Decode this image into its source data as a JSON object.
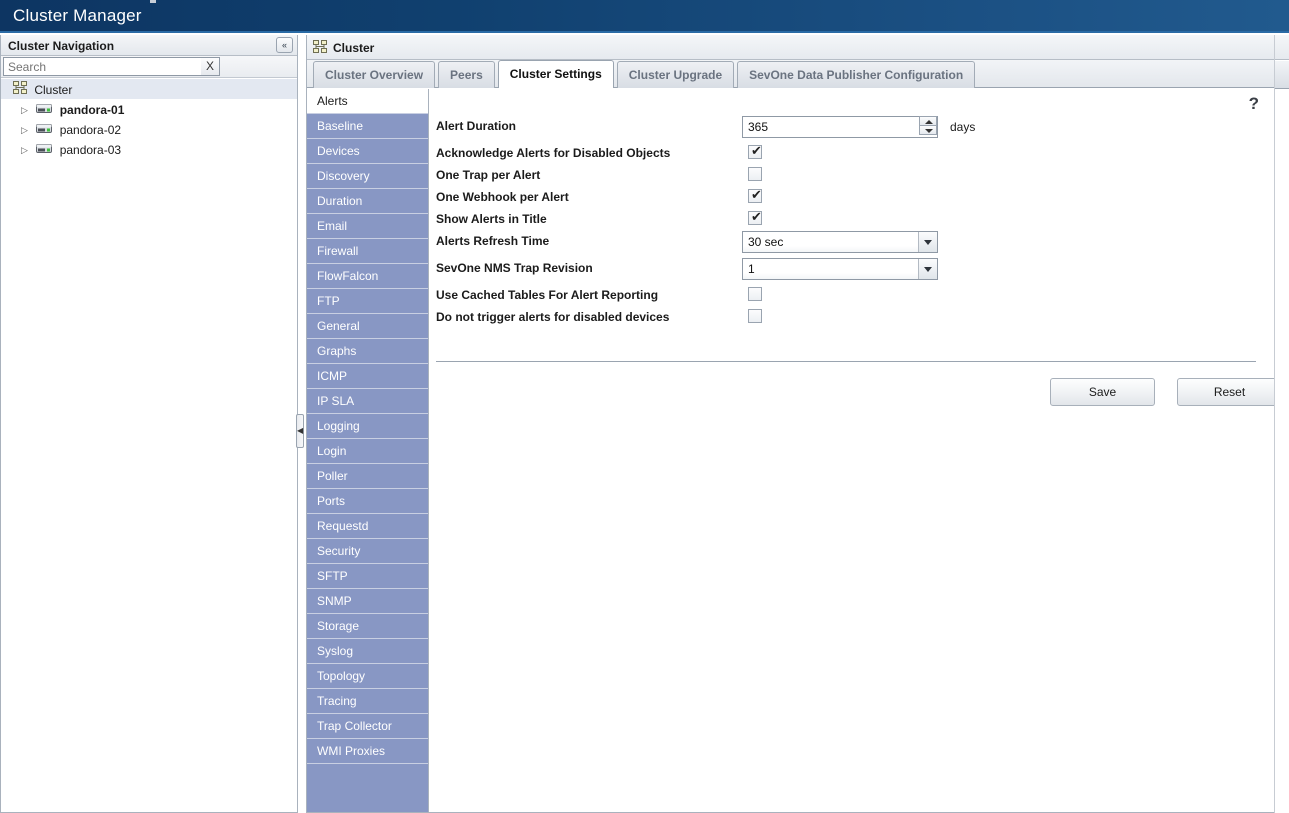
{
  "titlebar": {
    "title": "Cluster Manager"
  },
  "nav": {
    "header_title": "Cluster Navigation",
    "collapse_icon": "double-chevron-left-icon",
    "collapse_glyph": "«",
    "search": {
      "placeholder": "Search",
      "value": "",
      "clear_label": "X"
    },
    "tree": [
      {
        "label": "Cluster",
        "icon": "cluster-icon",
        "level": 0,
        "selected": true,
        "bold": false,
        "twisty": ""
      },
      {
        "label": "pandora-01",
        "icon": "server-icon",
        "level": 1,
        "selected": false,
        "bold": true,
        "twisty": "▷"
      },
      {
        "label": "pandora-02",
        "icon": "server-icon",
        "level": 1,
        "selected": false,
        "bold": false,
        "twisty": "▷"
      },
      {
        "label": "pandora-03",
        "icon": "server-icon",
        "level": 1,
        "selected": false,
        "bold": false,
        "twisty": "▷"
      }
    ]
  },
  "splitter": {
    "icon": "collapse-left-handle-icon",
    "glyph": "◀"
  },
  "breadcrumb": {
    "label": "Cluster",
    "icon": "cluster-icon"
  },
  "tabs": [
    {
      "label": "Cluster Overview",
      "active": false
    },
    {
      "label": "Peers",
      "active": false
    },
    {
      "label": "Cluster Settings",
      "active": true
    },
    {
      "label": "Cluster Upgrade",
      "active": false
    },
    {
      "label": "SevOne Data Publisher Configuration",
      "active": false
    }
  ],
  "submenu": [
    {
      "label": "Alerts",
      "active": true
    },
    {
      "label": "Baseline",
      "active": false
    },
    {
      "label": "Devices",
      "active": false
    },
    {
      "label": "Discovery",
      "active": false
    },
    {
      "label": "Duration",
      "active": false
    },
    {
      "label": "Email",
      "active": false
    },
    {
      "label": "Firewall",
      "active": false
    },
    {
      "label": "FlowFalcon",
      "active": false
    },
    {
      "label": "FTP",
      "active": false
    },
    {
      "label": "General",
      "active": false
    },
    {
      "label": "Graphs",
      "active": false
    },
    {
      "label": "ICMP",
      "active": false
    },
    {
      "label": "IP SLA",
      "active": false
    },
    {
      "label": "Logging",
      "active": false
    },
    {
      "label": "Login",
      "active": false
    },
    {
      "label": "Poller",
      "active": false
    },
    {
      "label": "Ports",
      "active": false
    },
    {
      "label": "Requestd",
      "active": false
    },
    {
      "label": "Security",
      "active": false
    },
    {
      "label": "SFTP",
      "active": false
    },
    {
      "label": "SNMP",
      "active": false
    },
    {
      "label": "Storage",
      "active": false
    },
    {
      "label": "Syslog",
      "active": false
    },
    {
      "label": "Topology",
      "active": false
    },
    {
      "label": "Tracing",
      "active": false
    },
    {
      "label": "Trap Collector",
      "active": false
    },
    {
      "label": "WMI Proxies",
      "active": false
    }
  ],
  "help": {
    "icon": "help-question-icon",
    "glyph": "?"
  },
  "form": {
    "alert_duration": {
      "label": "Alert Duration",
      "value": "365",
      "unit": "days"
    },
    "acknowledge_alerts_disabled_objects": {
      "label": "Acknowledge Alerts for Disabled Objects",
      "checked": true
    },
    "one_trap_per_alert": {
      "label": "One Trap per Alert",
      "checked": false
    },
    "one_webhook_per_alert": {
      "label": "One Webhook per Alert",
      "checked": true
    },
    "show_alerts_in_title": {
      "label": "Show Alerts in Title",
      "checked": true
    },
    "alerts_refresh_time": {
      "label": "Alerts Refresh Time",
      "value": "30 sec"
    },
    "sevone_nms_trap_revision": {
      "label": "SevOne NMS Trap Revision",
      "value": "1"
    },
    "use_cached_tables": {
      "label": "Use Cached Tables For Alert Reporting",
      "checked": false
    },
    "do_not_trigger_disabled_devices": {
      "label": "Do not trigger alerts for disabled devices",
      "checked": false
    },
    "check_glyph": "✔"
  },
  "buttons": {
    "save_label": "Save",
    "reset_label": "Reset"
  },
  "colors": {
    "titlebar_dark": "#0d3562",
    "titlebar_light": "#215a8e",
    "submenu_blue": "#8897c4",
    "tree_selected": "#e3e8f1",
    "border": "#a9b2bd"
  }
}
